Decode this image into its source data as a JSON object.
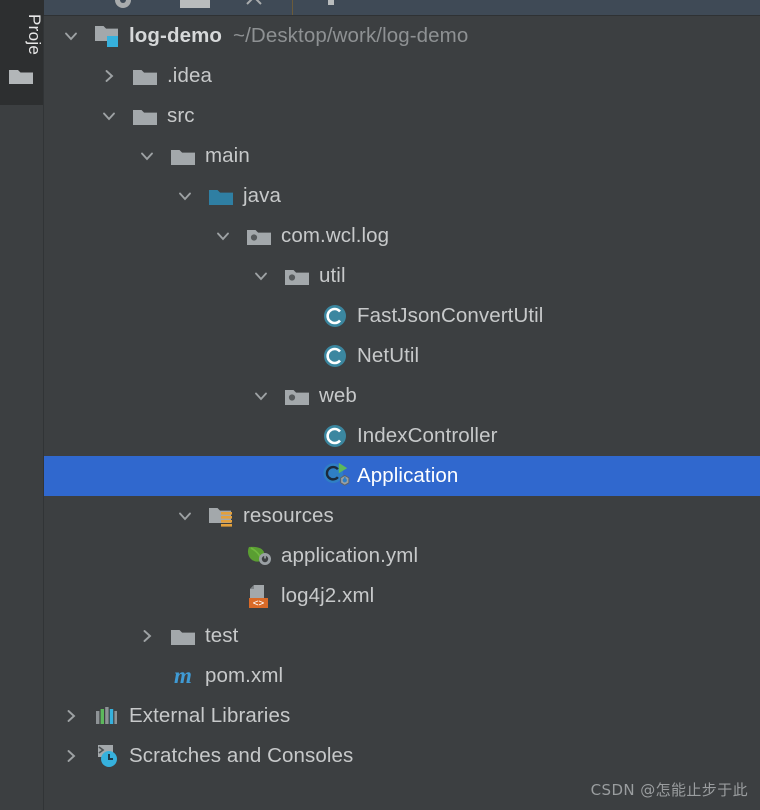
{
  "window": {
    "background_color": "#3c3f41",
    "selection_color": "#3068ce",
    "toolbar_color": "#3f4a56"
  },
  "tool_stripe": {
    "label": "Proje",
    "folder_icon": "folder-icon"
  },
  "toolbar": {
    "icons": [
      {
        "name": "settings-gear-icon"
      },
      {
        "name": "window-icon"
      },
      {
        "name": "collapse-icon"
      },
      {
        "name": "separator"
      },
      {
        "name": "more-icon"
      }
    ]
  },
  "tree": {
    "rows": [
      {
        "name": "project-root",
        "label": "log-demo",
        "path": "~/Desktop/work/log-demo",
        "depth": 0,
        "twisty": "chevron-down-icon",
        "icon": "module-folder-icon",
        "bold": true,
        "selected": false
      },
      {
        "name": "folder-idea",
        "label": ".idea",
        "depth": 1,
        "twisty": "chevron-right-icon",
        "icon": "folder-icon",
        "selected": false
      },
      {
        "name": "folder-src",
        "label": "src",
        "depth": 1,
        "twisty": "chevron-down-icon",
        "icon": "folder-icon",
        "selected": false
      },
      {
        "name": "folder-main",
        "label": "main",
        "depth": 2,
        "twisty": "chevron-down-icon",
        "icon": "folder-icon",
        "selected": false
      },
      {
        "name": "source-root-java",
        "label": "java",
        "depth": 3,
        "twisty": "chevron-down-icon",
        "icon": "source-folder-icon",
        "selected": false
      },
      {
        "name": "package-com-wcl-log",
        "label": "com.wcl.log",
        "depth": 4,
        "twisty": "chevron-down-icon",
        "icon": "package-icon",
        "selected": false
      },
      {
        "name": "package-util",
        "label": "util",
        "depth": 5,
        "twisty": "chevron-down-icon",
        "icon": "package-icon",
        "selected": false
      },
      {
        "name": "class-fastjsonconvertutil",
        "label": "FastJsonConvertUtil",
        "depth": 6,
        "twisty": null,
        "icon": "java-class-icon",
        "selected": false
      },
      {
        "name": "class-netutil",
        "label": "NetUtil",
        "depth": 6,
        "twisty": null,
        "icon": "java-class-icon",
        "selected": false
      },
      {
        "name": "package-web",
        "label": "web",
        "depth": 5,
        "twisty": "chevron-down-icon",
        "icon": "package-icon",
        "selected": false
      },
      {
        "name": "class-indexcontroller",
        "label": "IndexController",
        "depth": 6,
        "twisty": null,
        "icon": "java-class-icon",
        "selected": false
      },
      {
        "name": "class-application",
        "label": "Application",
        "depth": 6,
        "twisty": null,
        "icon": "spring-boot-main-class-icon",
        "selected": true
      },
      {
        "name": "resource-root-resources",
        "label": "resources",
        "depth": 3,
        "twisty": "chevron-down-icon",
        "icon": "resources-folder-icon",
        "selected": false
      },
      {
        "name": "file-application-yml",
        "label": "application.yml",
        "depth": 4,
        "twisty": null,
        "icon": "spring-yaml-icon",
        "selected": false
      },
      {
        "name": "file-log4j2-xml",
        "label": "log4j2.xml",
        "depth": 4,
        "twisty": null,
        "icon": "xml-file-icon",
        "selected": false
      },
      {
        "name": "folder-test",
        "label": "test",
        "depth": 2,
        "twisty": "chevron-right-icon",
        "icon": "folder-icon",
        "selected": false
      },
      {
        "name": "file-pom-xml",
        "label": "pom.xml",
        "depth": 2,
        "twisty": null,
        "icon": "maven-icon",
        "selected": false
      },
      {
        "name": "node-external-libraries",
        "label": "External Libraries",
        "depth": 0,
        "twisty": "chevron-right-icon",
        "icon": "libraries-icon",
        "selected": false
      },
      {
        "name": "node-scratches-and-consoles",
        "label": "Scratches and Consoles",
        "depth": 0,
        "twisty": "chevron-right-icon",
        "icon": "scratches-icon",
        "selected": false
      }
    ]
  },
  "watermark": {
    "text": "CSDN @怎能止步于此"
  }
}
